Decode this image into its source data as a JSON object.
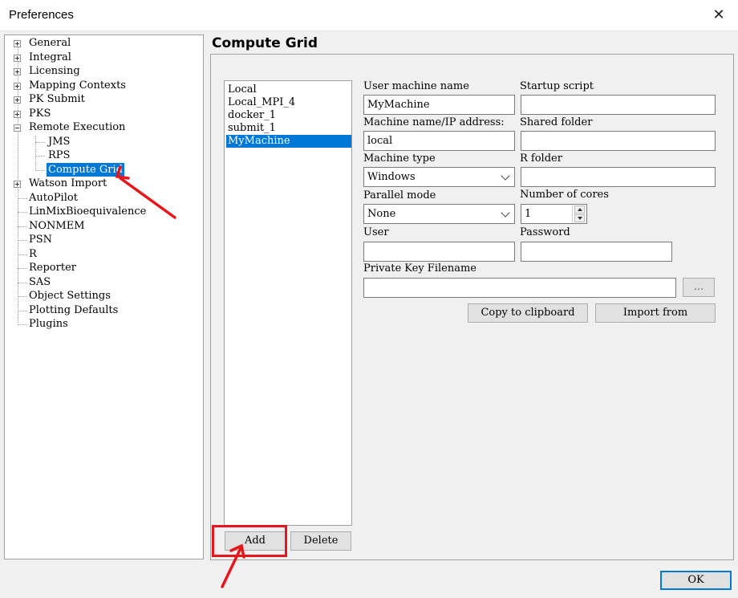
{
  "window": {
    "title": "Preferences",
    "close_symbol": "✕"
  },
  "tree": {
    "items": [
      {
        "label": "General"
      },
      {
        "label": "Integral"
      },
      {
        "label": "Licensing"
      },
      {
        "label": "Mapping Contexts"
      },
      {
        "label": "PK Submit"
      },
      {
        "label": "PKS"
      },
      {
        "label": "Remote Execution"
      },
      {
        "label": "JMS"
      },
      {
        "label": "RPS"
      },
      {
        "label": "Compute Grid"
      },
      {
        "label": "Watson Import"
      },
      {
        "label": "AutoPilot"
      },
      {
        "label": "LinMixBioequivalence"
      },
      {
        "label": "NONMEM"
      },
      {
        "label": "PSN"
      },
      {
        "label": "R"
      },
      {
        "label": "Reporter"
      },
      {
        "label": "SAS"
      },
      {
        "label": "Object Settings"
      },
      {
        "label": "Plotting Defaults"
      },
      {
        "label": "Plugins"
      }
    ],
    "selected": "Compute Grid"
  },
  "panel": {
    "header": "Compute Grid",
    "machines": [
      "Local",
      "Local_MPI_4",
      "docker_1",
      "submit_1",
      "MyMachine"
    ],
    "selected_machine": "MyMachine",
    "add_label": "Add",
    "delete_label": "Delete"
  },
  "form": {
    "user_machine_name_label": "User machine name",
    "user_machine_name_value": "MyMachine",
    "startup_script_label": "Startup script",
    "startup_script_value": "",
    "machine_ip_label": "Machine name/IP address:",
    "machine_ip_value": "local",
    "shared_folder_label": "Shared folder",
    "shared_folder_value": "",
    "machine_type_label": "Machine type",
    "machine_type_value": "Windows",
    "r_folder_label": "R folder",
    "r_folder_value": "",
    "parallel_mode_label": "Parallel mode",
    "parallel_mode_value": "None",
    "cores_label": "Number of cores",
    "cores_value": "1",
    "user_label": "User",
    "user_value": "",
    "password_label": "Password",
    "password_value": "",
    "private_key_label": "Private Key Filename",
    "private_key_value": "",
    "browse_label": "...",
    "copy_label": "Copy to clipboard",
    "import_label": "Import from"
  },
  "footer": {
    "ok_label": "OK"
  },
  "colors": {
    "selection": "#0078d7",
    "annotation": "#e8161c"
  }
}
